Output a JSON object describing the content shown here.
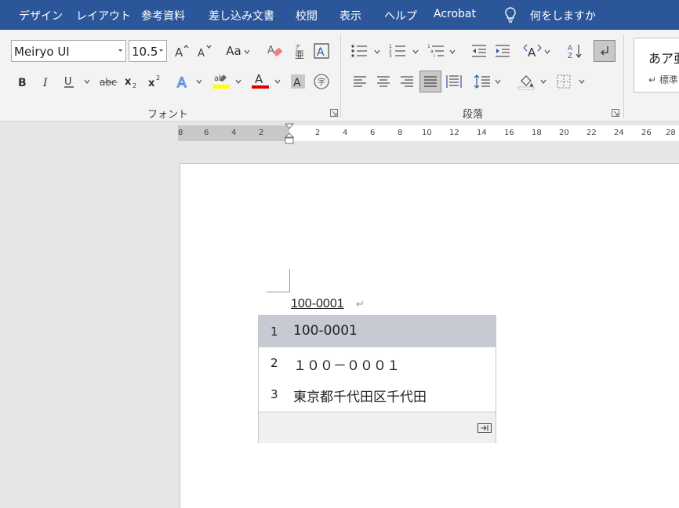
{
  "menu": {
    "items": [
      "デザイン",
      "レイアウト",
      "参考資料",
      "差し込み文書",
      "校閲",
      "表示",
      "ヘルプ",
      "Acrobat"
    ],
    "tell_me": "何をしますか"
  },
  "font_group": {
    "label": "フォント",
    "font_name": "Meiryo UI",
    "font_size": "10.5",
    "change_case_label": "Aa"
  },
  "paragraph_group": {
    "label": "段落"
  },
  "styles": {
    "preview": "あア亜",
    "name": "↵ 標準"
  },
  "ruler": {
    "left_ticks": [
      "8",
      "6",
      "4",
      "2"
    ],
    "right_ticks": [
      "2",
      "4",
      "6",
      "8",
      "10",
      "12",
      "14",
      "16",
      "18",
      "20",
      "22",
      "24",
      "26",
      "28"
    ]
  },
  "document": {
    "typed_text": "100-0001",
    "paragraph_mark": "↵"
  },
  "ime": {
    "candidates": [
      {
        "num": "1",
        "text": "100-0001"
      },
      {
        "num": "2",
        "text": "１００－０００１"
      },
      {
        "num": "3",
        "text": "東京都千代田区千代田"
      }
    ],
    "selected_index": 0
  },
  "colors": {
    "menubar": "#2b579a",
    "highlight": "#ffff00",
    "font_color": "#e00000",
    "selected_candidate": "#c5cad3"
  }
}
